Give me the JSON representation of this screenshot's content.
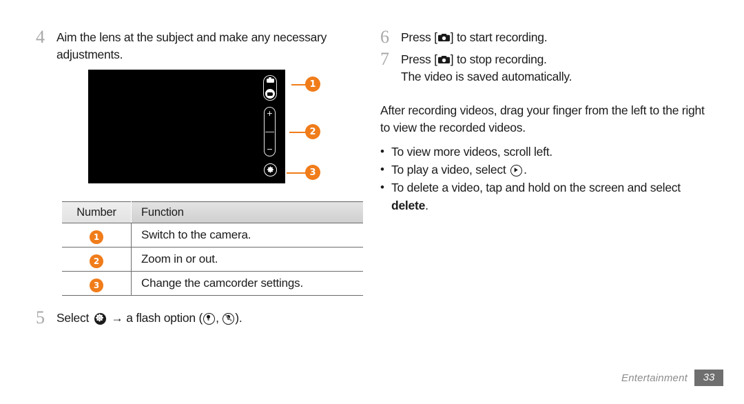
{
  "document": {
    "section": "Entertainment",
    "page_number": "33"
  },
  "left_column": {
    "step4": {
      "number": "4",
      "line1": "Aim the lens at the subject and make any necessary",
      "line2": "adjustments."
    },
    "preview": {
      "callouts": [
        {
          "label": "1",
          "target": "camera-camcorder-toggle"
        },
        {
          "label": "2",
          "target": "zoom-slider"
        },
        {
          "label": "3",
          "target": "camcorder-settings"
        }
      ],
      "zoom_in_symbol": "+",
      "zoom_out_symbol": "−"
    },
    "table": {
      "headers": [
        "Number",
        "Function"
      ],
      "rows": [
        {
          "number": "1",
          "function": "Switch to the camera."
        },
        {
          "number": "2",
          "function": "Zoom in or out."
        },
        {
          "number": "3",
          "function": "Change the camcorder settings."
        }
      ]
    },
    "step5": {
      "number": "5",
      "text_before": "Select",
      "arrow": "→",
      "text_mid": "a flash option (",
      "comma": ", ",
      "text_after": ").",
      "icons": [
        "settings-gear-icon",
        "flash-on-icon",
        "flash-off-icon"
      ]
    }
  },
  "right_column": {
    "step6": {
      "number": "6",
      "before": "Press [",
      "after": "] to start recording."
    },
    "step7": {
      "number": "7",
      "before": "Press [",
      "after": "] to stop recording.",
      "line2": "The video is saved automatically."
    },
    "paragraph": {
      "line1": "After recording videos, drag your finger from the left to the",
      "line2": "right to view the recorded videos."
    },
    "bullets": [
      {
        "marker": "•",
        "text": "To view more videos, scroll left."
      },
      {
        "marker": "•",
        "text_before": "To play a video, select",
        "text_after": ".",
        "icon": "play-icon"
      },
      {
        "marker": "•",
        "line1": "To delete a video, tap and hold on the screen and select",
        "bold_word": "delete",
        "period": "."
      }
    ]
  },
  "colors": {
    "accent_orange": "#f07c1a",
    "text": "#1b1b1b",
    "step_number_gray": "#a8a8a8",
    "footer_gray": "#8c8c8c",
    "page_badge_bg": "#6f6f6f",
    "table_rule": "#6b6b6b"
  }
}
